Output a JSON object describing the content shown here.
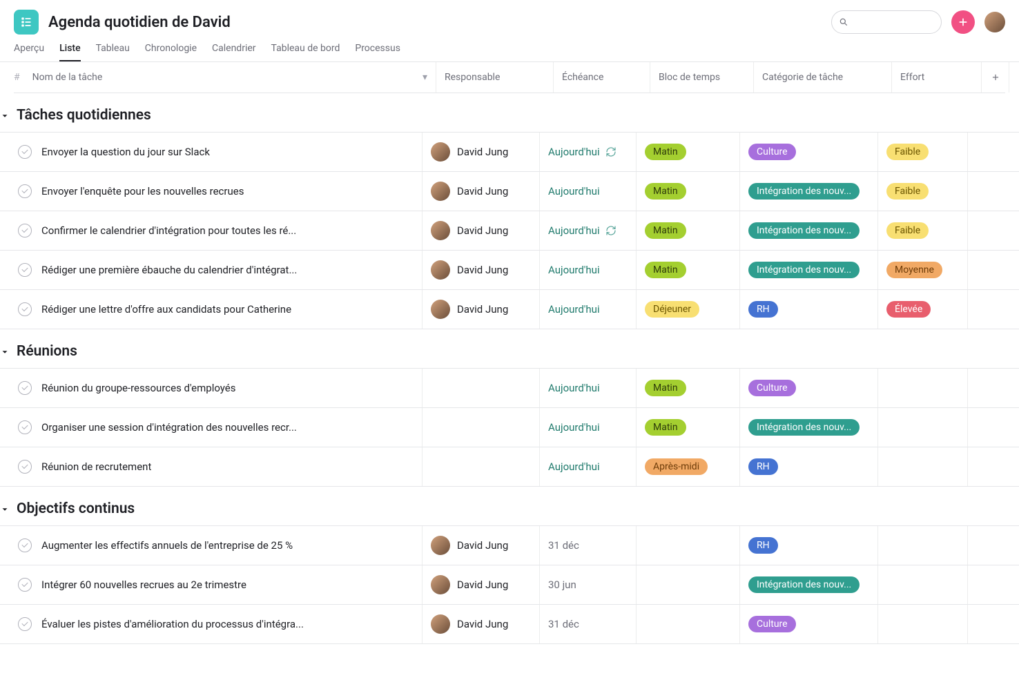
{
  "header": {
    "title": "Agenda quotidien de David"
  },
  "tabs": [
    {
      "label": "Aperçu",
      "active": false
    },
    {
      "label": "Liste",
      "active": true
    },
    {
      "label": "Tableau",
      "active": false
    },
    {
      "label": "Chronologie",
      "active": false
    },
    {
      "label": "Calendrier",
      "active": false
    },
    {
      "label": "Tableau de bord",
      "active": false
    },
    {
      "label": "Processus",
      "active": false
    }
  ],
  "columns": {
    "hash": "#",
    "task": "Nom de la tâche",
    "assignee": "Responsable",
    "due": "Échéance",
    "block": "Bloc de temps",
    "category": "Catégorie de tâche",
    "effort": "Effort"
  },
  "badge_colors": {
    "Matin": "bg-green",
    "Déjeuner": "bg-yellow",
    "Après-midi": "bg-orange",
    "Culture": "bg-purple",
    "Intégration des nouv...": "bg-teal",
    "RH": "bg-blue",
    "Faible": "bg-yellow",
    "Moyenne": "bg-orange",
    "Élevée": "bg-red"
  },
  "sections": [
    {
      "title": "Tâches quotidiennes",
      "rows": [
        {
          "task": "Envoyer la question du jour sur Slack",
          "assignee": "David Jung",
          "due": "Aujourd'hui",
          "due_muted": false,
          "repeat": true,
          "block": "Matin",
          "category": "Culture",
          "effort": "Faible"
        },
        {
          "task": "Envoyer l'enquête pour les nouvelles recrues",
          "assignee": "David Jung",
          "due": "Aujourd'hui",
          "due_muted": false,
          "repeat": false,
          "block": "Matin",
          "category": "Intégration des nouv...",
          "effort": "Faible"
        },
        {
          "task": "Confirmer le calendrier d'intégration pour toutes les ré...",
          "assignee": "David Jung",
          "due": "Aujourd'hui",
          "due_muted": false,
          "repeat": true,
          "block": "Matin",
          "category": "Intégration des nouv...",
          "effort": "Faible"
        },
        {
          "task": "Rédiger une première ébauche du calendrier d'intégrat...",
          "assignee": "David Jung",
          "due": "Aujourd'hui",
          "due_muted": false,
          "repeat": false,
          "block": "Matin",
          "category": "Intégration des nouv...",
          "effort": "Moyenne"
        },
        {
          "task": "Rédiger une lettre d'offre aux candidats pour Catherine",
          "assignee": "David Jung",
          "due": "Aujourd'hui",
          "due_muted": false,
          "repeat": false,
          "block": "Déjeuner",
          "category": "RH",
          "effort": "Élevée"
        }
      ]
    },
    {
      "title": "Réunions",
      "rows": [
        {
          "task": "Réunion du groupe-ressources d'employés",
          "assignee": "",
          "due": "Aujourd'hui",
          "due_muted": false,
          "repeat": false,
          "block": "Matin",
          "category": "Culture",
          "effort": ""
        },
        {
          "task": "Organiser une session d'intégration des nouvelles recr...",
          "assignee": "",
          "due": "Aujourd'hui",
          "due_muted": false,
          "repeat": false,
          "block": "Matin",
          "category": "Intégration des nouv...",
          "effort": ""
        },
        {
          "task": "Réunion de recrutement",
          "assignee": "",
          "due": "Aujourd'hui",
          "due_muted": false,
          "repeat": false,
          "block": "Après-midi",
          "category": "RH",
          "effort": ""
        }
      ]
    },
    {
      "title": "Objectifs continus",
      "rows": [
        {
          "task": "Augmenter les effectifs annuels de l'entreprise de 25 %",
          "assignee": "David Jung",
          "due": "31 déc",
          "due_muted": true,
          "repeat": false,
          "block": "",
          "category": "RH",
          "effort": ""
        },
        {
          "task": "Intégrer 60 nouvelles recrues au 2e trimestre",
          "assignee": "David Jung",
          "due": "30 jun",
          "due_muted": true,
          "repeat": false,
          "block": "",
          "category": "Intégration des nouv...",
          "effort": ""
        },
        {
          "task": "Évaluer les pistes d'amélioration du processus d'intégra...",
          "assignee": "David Jung",
          "due": "31 déc",
          "due_muted": true,
          "repeat": false,
          "block": "",
          "category": "Culture",
          "effort": ""
        }
      ]
    }
  ]
}
